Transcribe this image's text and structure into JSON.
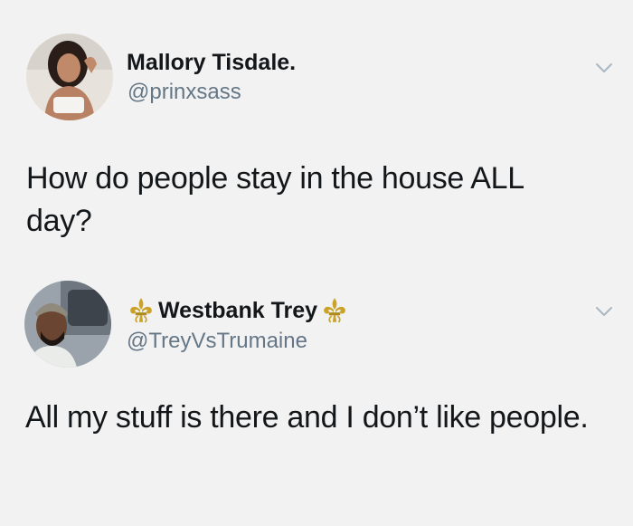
{
  "tweets": [
    {
      "display_name": "Mallory Tisdale.",
      "handle": "@prinxsass",
      "text": "How do people stay in the house ALL day?",
      "avatar_icon": "profile-photo-woman",
      "menu_icon": "chevron-down-icon"
    },
    {
      "display_name": "Westbank Trey",
      "handle": "@TreyVsTrumaine",
      "text": "All my stuff is there and I don’t like people.",
      "avatar_icon": "profile-photo-man",
      "name_emoji": "fleur-de-lis",
      "menu_icon": "chevron-down-icon"
    }
  ],
  "colors": {
    "background": "#f2f2f2",
    "text": "#14171a",
    "secondary": "#657786",
    "fleur_gold": "#c9a227"
  }
}
